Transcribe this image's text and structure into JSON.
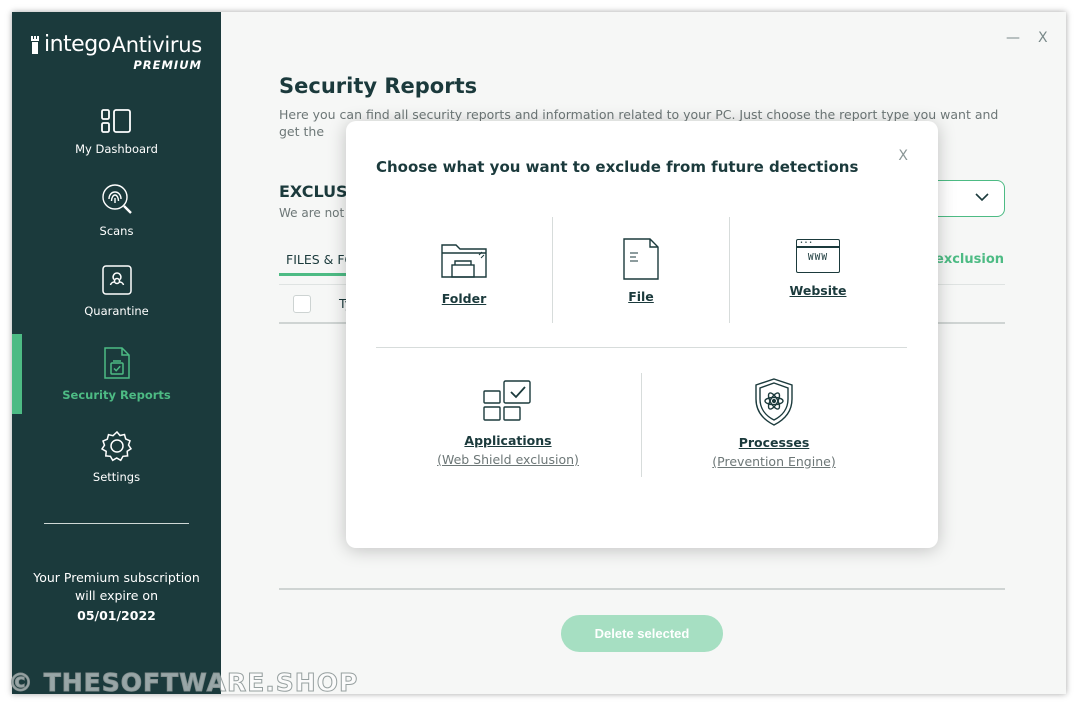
{
  "app": {
    "brand": "intego",
    "product": "Antivirus",
    "edition": "PREMIUM"
  },
  "sidebar": {
    "items": [
      {
        "label": "My Dashboard",
        "icon": "dashboard-icon",
        "active": false
      },
      {
        "label": "Scans",
        "icon": "fingerprint-scan-icon",
        "active": false
      },
      {
        "label": "Quarantine",
        "icon": "biohazard-icon",
        "active": false
      },
      {
        "label": "Security Reports",
        "icon": "report-icon",
        "active": true
      },
      {
        "label": "Settings",
        "icon": "gear-icon",
        "active": false
      }
    ],
    "subscription_text": "Your Premium subscription will expire on",
    "subscription_date": "05/01/2022"
  },
  "window_controls": {
    "minimize": "—",
    "close": "X"
  },
  "main": {
    "title": "Security Reports",
    "description": "Here you can find all security reports and information related to your PC. Just choose the report type you want and get the",
    "section_title": "EXCLUS",
    "section_desc": "We are not",
    "tab_label": "FILES & FO",
    "add_exclusion_label": "exclusion",
    "table_col_label": "Ty",
    "delete_button": "Delete selected"
  },
  "modal": {
    "title": "Choose what you want to exclude from future detections",
    "close": "X",
    "options": {
      "folder": {
        "label": "Folder",
        "icon": "folder-icon"
      },
      "file": {
        "label": "File",
        "icon": "file-icon"
      },
      "website": {
        "label": "Website",
        "icon": "www-icon",
        "icon_text": "WWW"
      },
      "applications": {
        "label": "Applications",
        "sub": "(Web Shield exclusion)",
        "icon": "applications-icon"
      },
      "processes": {
        "label": "Processes",
        "sub": "(Prevention Engine)",
        "icon": "shield-atom-icon"
      }
    }
  },
  "watermark": "© THESOFTWARE.SHOP",
  "colors": {
    "sidebar_bg": "#1b3a3c",
    "accent": "#4dbb84",
    "button_disabled": "#a6dfc2",
    "text_dark": "#1b3a3c"
  }
}
